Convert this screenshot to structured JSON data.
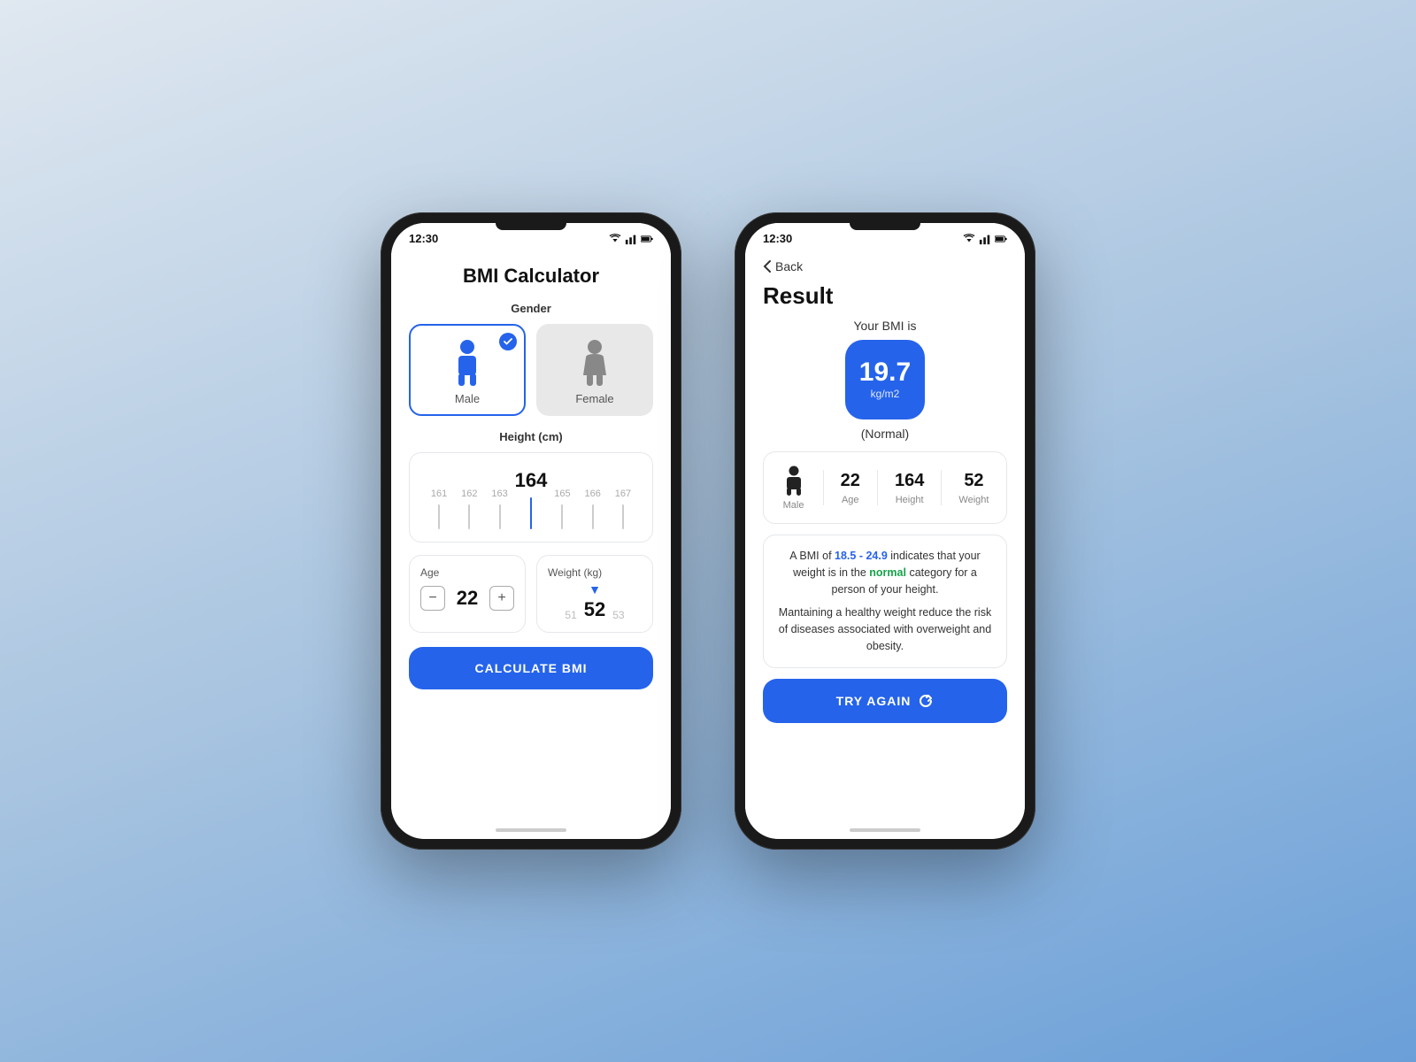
{
  "screen1": {
    "statusTime": "12:30",
    "title": "BMI Calculator",
    "genderLabel": "Gender",
    "genderOptions": [
      {
        "id": "male",
        "label": "Male",
        "selected": true
      },
      {
        "id": "female",
        "label": "Female",
        "selected": false
      }
    ],
    "heightLabel": "Height (cm)",
    "heightRuler": [
      161,
      162,
      163,
      164,
      165,
      166,
      167
    ],
    "heightSelected": 164,
    "ageLabel": "Age",
    "ageValue": "22",
    "weightLabel": "Weight (kg)",
    "weightValues": [
      "51",
      "52",
      "53"
    ],
    "weightSelected": "52",
    "calcButton": "CALCULATE BMI"
  },
  "screen2": {
    "statusTime": "12:30",
    "backLabel": "Back",
    "resultTitle": "Result",
    "bmiLabel": "Your BMI is",
    "bmiValue": "19.7",
    "bmiUnit": "kg/m2",
    "bmiCategory": "(Normal)",
    "stats": [
      {
        "label": "Male",
        "value": "♟"
      },
      {
        "label": "Age",
        "value": "22"
      },
      {
        "label": "Height",
        "value": "164"
      },
      {
        "label": "Weight",
        "value": "52"
      }
    ],
    "infoRange": "18.5 - 24.9",
    "infoText1": "A BMI of 18.5 - 24.9 indicates that your weight is in the normal category for a person of your height.",
    "infoText2": "Mantaining a healthy weight reduce the risk of diseases associated with overweight and obesity.",
    "tryAgainBtn": "TRY AGAIN"
  },
  "colors": {
    "brand": "#2563eb",
    "bg": "#f0f2f5"
  }
}
